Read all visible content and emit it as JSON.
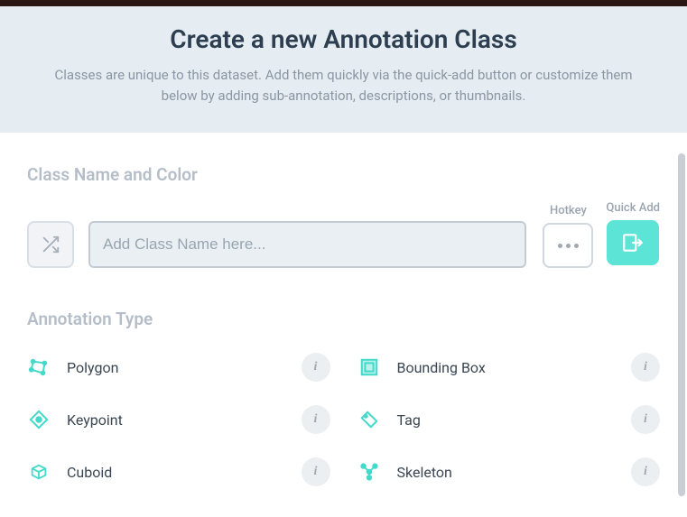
{
  "header": {
    "title": "Create a new Annotation Class",
    "subtitle": "Classes are unique to this dataset. Add them quickly via the quick-add button or customize them below by adding sub-annotation, descriptions, or thumbnails."
  },
  "sections": {
    "name_label": "Class Name and Color",
    "type_label": "Annotation Type"
  },
  "inputs": {
    "name_placeholder": "Add Class Name here...",
    "name_value": ""
  },
  "buttons": {
    "hotkey_label": "Hotkey",
    "quickadd_label": "Quick Add"
  },
  "types": [
    {
      "id": "polygon",
      "label": "Polygon",
      "icon": "polygon-icon",
      "color": "#45d9c9"
    },
    {
      "id": "bounding_box",
      "label": "Bounding Box",
      "icon": "bbox-icon",
      "color": "#45d9c9"
    },
    {
      "id": "keypoint",
      "label": "Keypoint",
      "icon": "keypoint-icon",
      "color": "#45d9c9"
    },
    {
      "id": "tag",
      "label": "Tag",
      "icon": "tag-icon",
      "color": "#45d9c9"
    },
    {
      "id": "cuboid",
      "label": "Cuboid",
      "icon": "cuboid-icon",
      "color": "#45d9c9"
    },
    {
      "id": "skeleton",
      "label": "Skeleton",
      "icon": "skeleton-icon",
      "color": "#45d9c9"
    }
  ],
  "info_glyph": "i",
  "colors": {
    "accent": "#5ce5d6",
    "icon_teal": "#45d9c9"
  }
}
